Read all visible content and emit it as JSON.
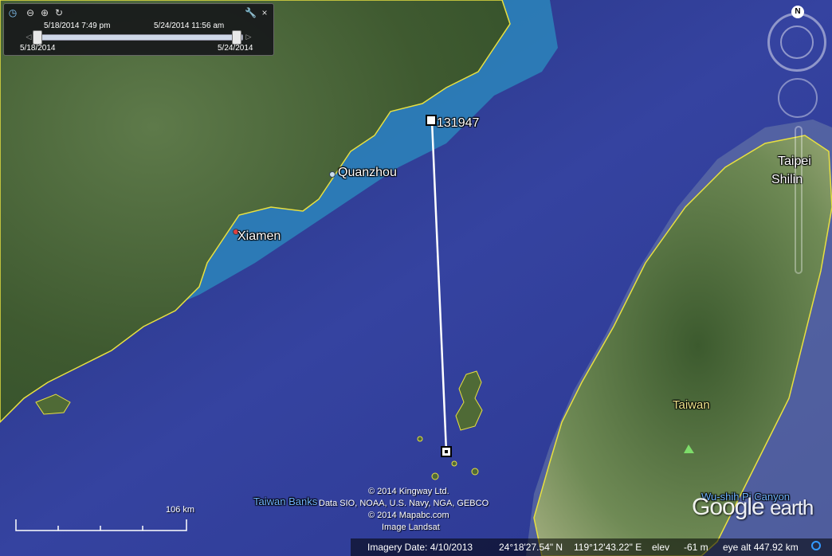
{
  "timeline": {
    "current_start": "5/18/2014   7:49 pm",
    "current_end": "5/24/2014  11:56 am",
    "range_start": "5/18/2014",
    "range_end": "5/24/2014"
  },
  "navigation": {
    "north_label": "N"
  },
  "map": {
    "places": {
      "quanzhou": "Quanzhou",
      "xiamen": "Xiamen",
      "taipei": "Taipei",
      "shilin": "Shilin",
      "taiwan": "Taiwan",
      "taiwan_banks": "Taiwan Banks",
      "wushin_canyon": "Wu-shih Pi Canyon"
    },
    "marker_label": "131947"
  },
  "credits": {
    "line1": "© 2014 Kingway Ltd.",
    "line2": "Data SIO, NOAA, U.S. Navy, NGA, GEBCO",
    "line3": "© 2014 Mapabc.com",
    "line4": "Image Landsat"
  },
  "scale": {
    "label": "106 km"
  },
  "logo": {
    "google": "Google",
    "earth": "earth"
  },
  "status": {
    "imagery_date": "Imagery Date: 4/10/2013",
    "latitude": "24°18'27.54\" N",
    "longitude": "119°12'43.22\" E",
    "elevation_label": "elev",
    "elevation": "-61 m",
    "eye_alt": "eye alt 447.92 km"
  },
  "colors": {
    "sea": "#2d3a8c",
    "land": "#4a6a3a",
    "border": "#e8e040",
    "shallow": "#2b8fc0"
  }
}
